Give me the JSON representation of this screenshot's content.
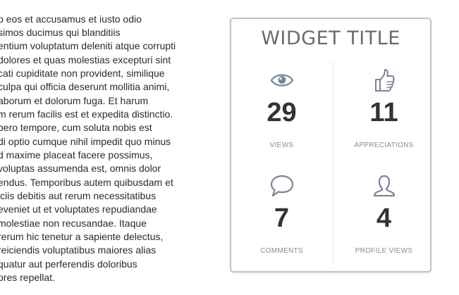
{
  "body_text": {
    "lines": [
      "o eos et accusamus et iusto odio",
      "simos ducimus qui blanditiis",
      "entium voluptatum deleniti atque corrupti",
      "dolores et quas molestias excepturi sint",
      "cati cupiditate non provident, similique",
      " culpa qui officia deserunt mollitia animi,",
      "aborum et dolorum fuga. Et harum",
      "m rerum facilis est et expedita distinctio.",
      "bero tempore, cum soluta nobis est",
      "di optio cumque nihil impedit quo minus",
      "d maxime placeat facere possimus,",
      " voluptas assumenda est, omnis dolor",
      "endus. Temporibus autem quibusdam et",
      "iciis debitis aut rerum necessitatibus",
      " eveniet ut et voluptates repudiandae",
      " molestiae non recusandae. Itaque",
      " rerum hic tenetur a sapiente delectus,",
      "reiciendis voluptatibus maiores alias",
      "quatur aut perferendis doloribus",
      "ores repellat."
    ]
  },
  "widget": {
    "title": "WIDGET TITLE",
    "icon_color": "#7a8599",
    "stats": [
      {
        "icon": "eye-icon",
        "value": "29",
        "label": "VIEWS"
      },
      {
        "icon": "thumbs-up-icon",
        "value": "11",
        "label": "APPRECIATIONS"
      },
      {
        "icon": "speech-bubble-icon",
        "value": "7",
        "label": "COMMENTS"
      },
      {
        "icon": "user-icon",
        "value": "4",
        "label": "PROFILE VIEWS"
      }
    ]
  }
}
